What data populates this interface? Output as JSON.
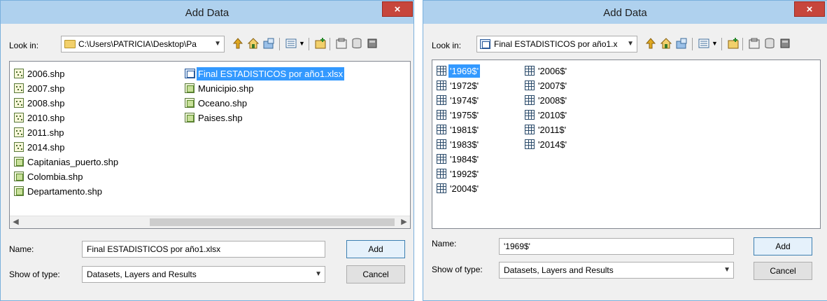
{
  "left": {
    "title": "Add Data",
    "look_in_label": "Look in:",
    "look_in_value": "C:\\Users\\PATRICIA\\Desktop\\Pa",
    "files_col1": [
      {
        "name": "2006.shp",
        "icon": "point-shapefile-icon"
      },
      {
        "name": "2007.shp",
        "icon": "point-shapefile-icon"
      },
      {
        "name": "2008.shp",
        "icon": "point-shapefile-icon"
      },
      {
        "name": "2010.shp",
        "icon": "point-shapefile-icon"
      },
      {
        "name": "2011.shp",
        "icon": "point-shapefile-icon"
      },
      {
        "name": "2014.shp",
        "icon": "point-shapefile-icon"
      },
      {
        "name": "Capitanias_puerto.shp",
        "icon": "polygon-shapefile-icon"
      },
      {
        "name": "Colombia.shp",
        "icon": "polygon-shapefile-icon"
      },
      {
        "name": "Departamento.shp",
        "icon": "polygon-shapefile-icon"
      }
    ],
    "files_col2": [
      {
        "name": "Final ESTADISTICOS por año1.xlsx",
        "icon": "excel-workbook-icon",
        "selected": true
      },
      {
        "name": "Municipio.shp",
        "icon": "polygon-shapefile-icon"
      },
      {
        "name": "Oceano.shp",
        "icon": "polygon-shapefile-icon"
      },
      {
        "name": "Paises.shp",
        "icon": "polygon-shapefile-icon"
      }
    ],
    "name_label": "Name:",
    "name_value": "Final ESTADISTICOS por año1.xlsx",
    "type_label": "Show of type:",
    "type_value": "Datasets, Layers and Results",
    "add_label": "Add",
    "cancel_label": "Cancel",
    "close_glyph": "×"
  },
  "right": {
    "title": "Add Data",
    "look_in_label": "Look in:",
    "look_in_value": "Final ESTADISTICOS por año1.x",
    "sheets_col1": [
      "'1969$'",
      "'1972$'",
      "'1974$'",
      "'1975$'",
      "'1981$'",
      "'1983$'",
      "'1984$'",
      "'1992$'",
      "'2004$'"
    ],
    "sheets_col2": [
      "'2006$'",
      "'2007$'",
      "'2008$'",
      "'2010$'",
      "'2011$'",
      "'2014$'"
    ],
    "selected_sheet": "'1969$'",
    "name_label": "Name:",
    "name_value": "'1969$'",
    "type_label": "Show of type:",
    "type_value": "Datasets, Layers and Results",
    "add_label": "Add",
    "cancel_label": "Cancel",
    "close_glyph": "×"
  },
  "colors": {
    "titlebar": "#afd1ee",
    "close": "#c7463c",
    "selection": "#3399ff",
    "dialog_bg": "#f0f0f0"
  }
}
